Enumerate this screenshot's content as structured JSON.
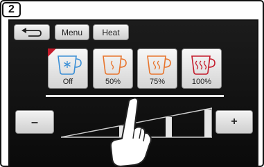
{
  "step": {
    "number": "2"
  },
  "nav": {
    "back_icon": "back-arrow-icon",
    "menu_label": "Menu",
    "heat_label": "Heat"
  },
  "levels": [
    {
      "label": "Off",
      "icon": "snowflake-cup-icon",
      "color": "#3a8fd6",
      "selected": true
    },
    {
      "label": "50%",
      "icon": "warm-cup-icon",
      "color": "#e8742c",
      "selected": false
    },
    {
      "label": "75%",
      "icon": "warm-cup-icon",
      "color": "#e8742c",
      "selected": false
    },
    {
      "label": "100%",
      "icon": "hot-cup-icon",
      "color": "#c41a2a",
      "selected": false
    }
  ],
  "slider": {
    "minus_label": "–",
    "plus_label": "+",
    "steps_shown": 3
  },
  "overlay": {
    "icon": "pointing-hand-icon"
  }
}
